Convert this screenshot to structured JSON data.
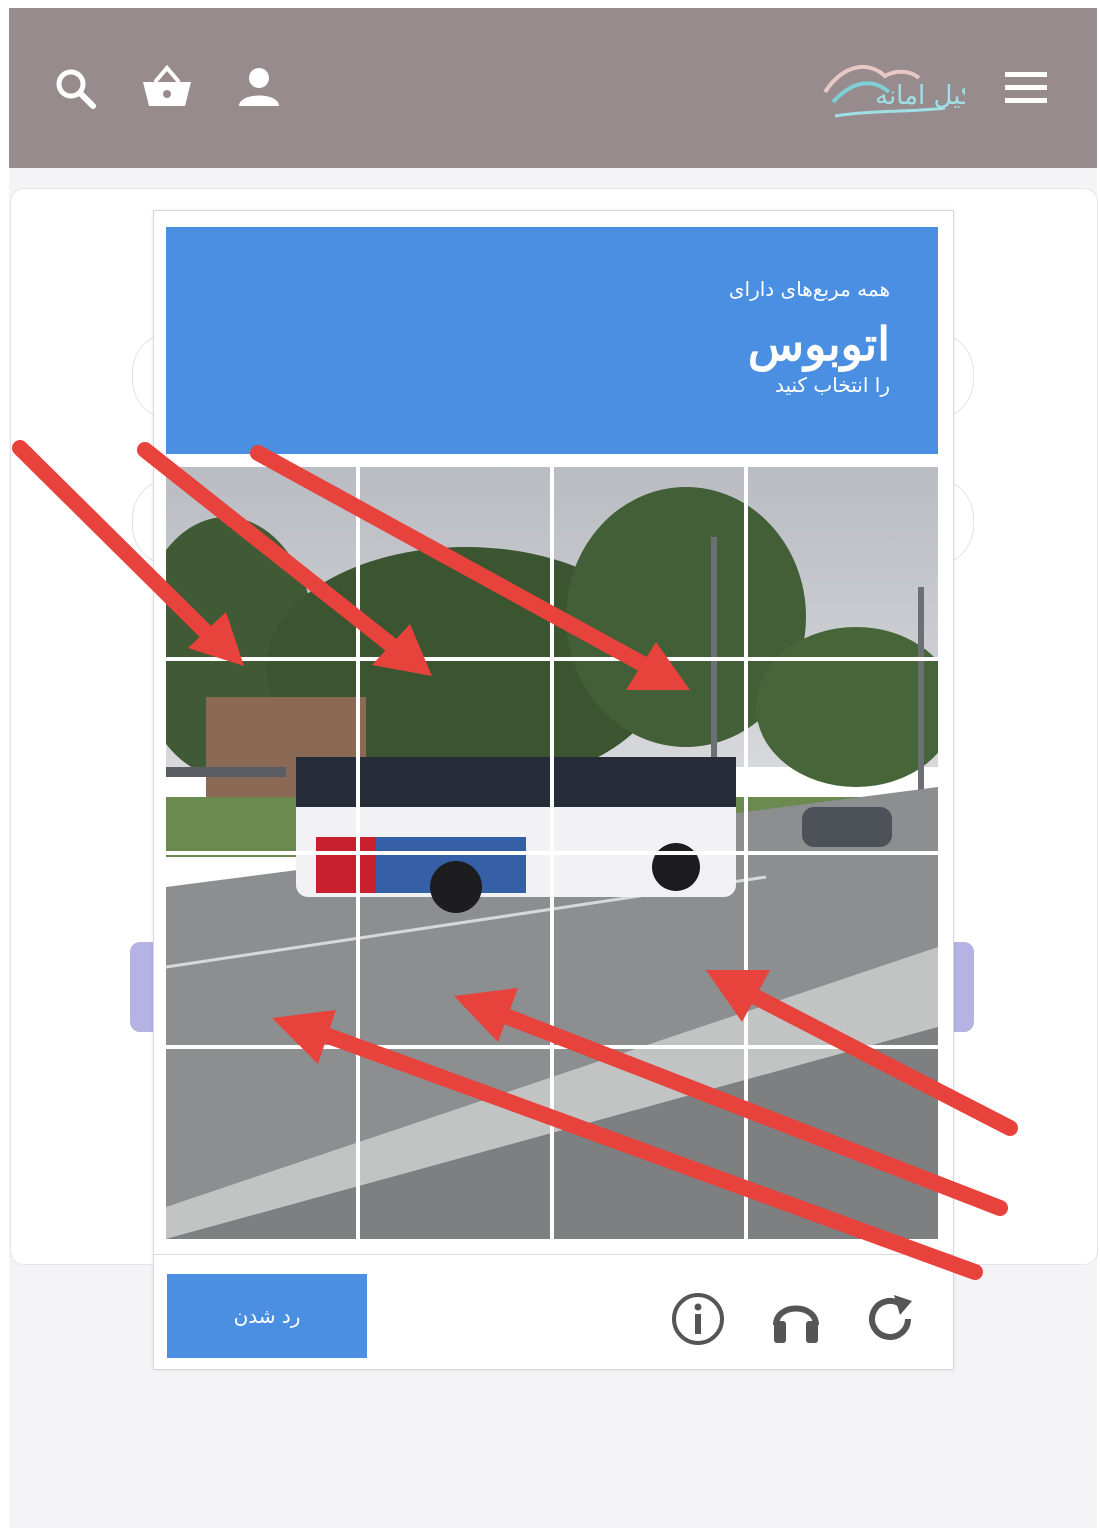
{
  "header": {
    "bg_color": "#978b8e",
    "logo_text": "کیل امانه",
    "icons": [
      "search-icon",
      "basket-icon",
      "user-icon",
      "menu-icon"
    ]
  },
  "captcha": {
    "instruction_top": "همه مربع‌های دارای",
    "object_label": "اتوبوس",
    "instruction_bottom": "را انتخاب کنید",
    "verify_button_label": "رد شدن",
    "accent_color": "#4a8fe2",
    "grid_size": "4x4",
    "footer_icons": [
      "info-icon",
      "headphones-icon",
      "reload-icon"
    ]
  },
  "annotations": {
    "arrow_color": "#e8423d",
    "arrow_count": 6
  }
}
